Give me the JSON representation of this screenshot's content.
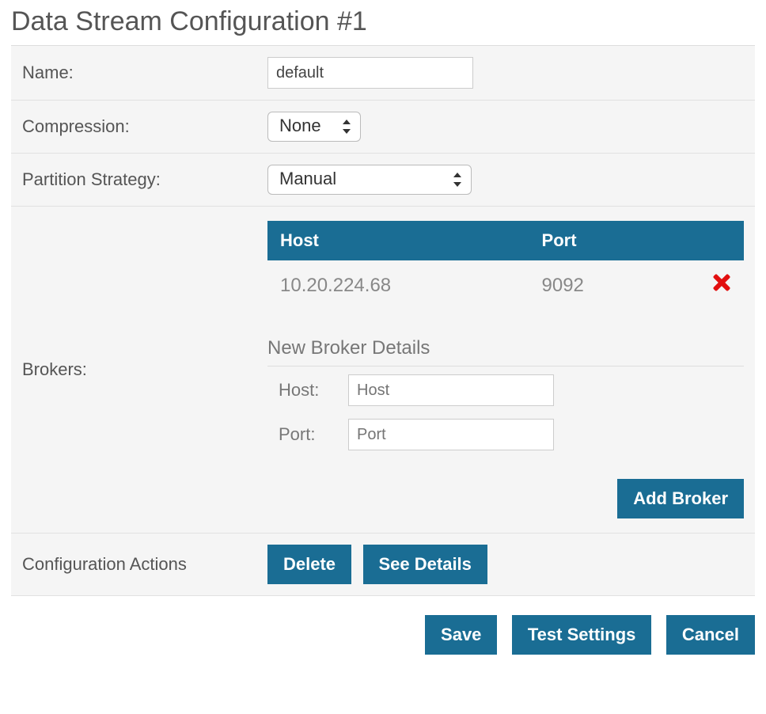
{
  "title": "Data Stream Configuration #1",
  "fields": {
    "name_label": "Name:",
    "name_value": "default",
    "compression_label": "Compression:",
    "compression_value": "None",
    "partition_label": "Partition Strategy:",
    "partition_value": "Manual",
    "brokers_label": "Brokers:"
  },
  "brokers_table": {
    "col_host": "Host",
    "col_port": "Port",
    "rows": [
      {
        "host": "10.20.224.68",
        "port": "9092"
      }
    ]
  },
  "new_broker": {
    "heading": "New Broker Details",
    "host_label": "Host:",
    "host_placeholder": "Host",
    "port_label": "Port:",
    "port_placeholder": "Port",
    "add_button": "Add Broker"
  },
  "config_actions": {
    "label": "Configuration Actions",
    "delete": "Delete",
    "details": "See Details"
  },
  "footer": {
    "save": "Save",
    "test": "Test Settings",
    "cancel": "Cancel"
  }
}
